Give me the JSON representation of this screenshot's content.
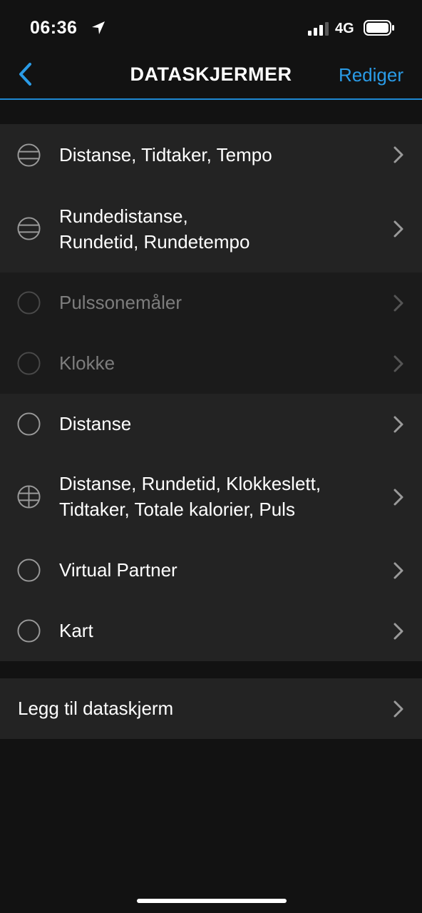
{
  "status_bar": {
    "time": "06:36",
    "network": "4G"
  },
  "nav": {
    "title": "DATASKJERMER",
    "edit_label": "Rediger",
    "accent_color": "#2a9be6"
  },
  "screens": [
    {
      "label_line1": "Distanse, Tidtaker, Tempo",
      "label_line2": "",
      "icon": "three-field-layout-icon",
      "enabled": true
    },
    {
      "label_line1": "Rundedistanse,",
      "label_line2": "Rundetid, Rundetempo",
      "icon": "three-field-layout-icon",
      "enabled": true
    },
    {
      "label_line1": "Pulssonemåler",
      "label_line2": "",
      "icon": "empty-circle-icon",
      "enabled": false
    },
    {
      "label_line1": "Klokke",
      "label_line2": "",
      "icon": "empty-circle-icon",
      "enabled": false
    },
    {
      "label_line1": "Distanse",
      "label_line2": "",
      "icon": "empty-circle-icon",
      "enabled": true
    },
    {
      "label_line1": "Distanse, Rundetid, Klokkeslett,",
      "label_line2": "Tidtaker, Totale kalorier, Puls",
      "icon": "six-field-layout-icon",
      "enabled": true
    },
    {
      "label_line1": "Virtual Partner",
      "label_line2": "",
      "icon": "empty-circle-icon",
      "enabled": true
    },
    {
      "label_line1": "Kart",
      "label_line2": "",
      "icon": "empty-circle-icon",
      "enabled": true
    }
  ],
  "add_screen": {
    "label": "Legg til dataskjerm"
  }
}
